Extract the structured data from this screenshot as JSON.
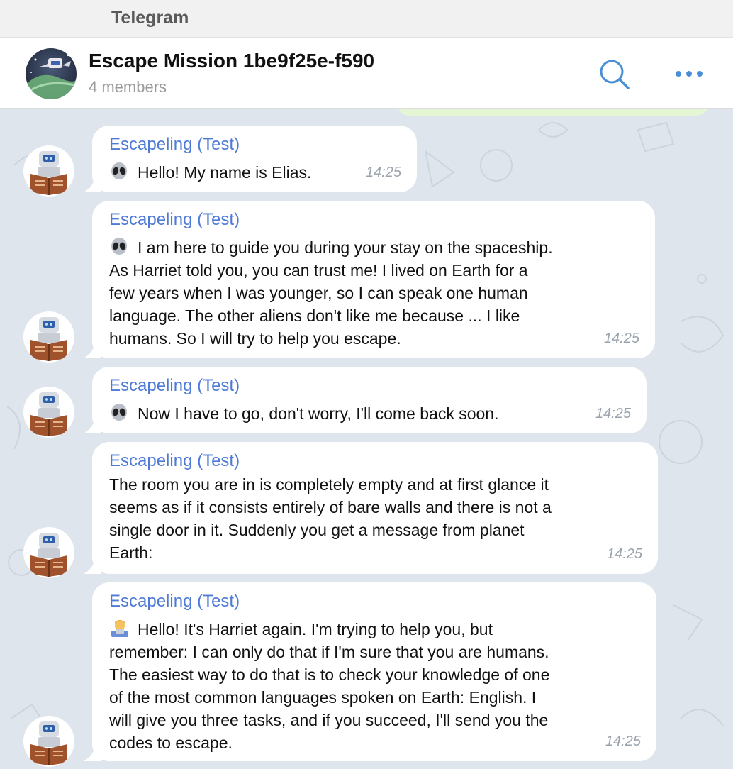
{
  "window": {
    "title": "Telegram"
  },
  "chat": {
    "title": "Escape Mission 1be9f25e-f590",
    "subtitle": "4 members"
  },
  "header_icons": {
    "search": "search-icon",
    "more": "more-dots-icon"
  },
  "colors": {
    "accent": "#4f7bd6",
    "bubble": "#ffffff",
    "background": "#dfe5ec",
    "outgoing_bubble": "#e4f6d4"
  },
  "messages": [
    {
      "sender": "Escapeling (Test)",
      "emoji": "alien",
      "text": "Hello! My name is Elias.",
      "time": "14:25"
    },
    {
      "sender": "Escapeling (Test)",
      "emoji": "alien",
      "text": "I am here to guide you during your stay on the spaceship.\nAs Harriet told you, you can trust me! I lived on Earth for a\nfew years when I was younger, so I can speak one human\nlanguage. The other aliens don't like me because ... I like\nhumans. So I will try to help you escape.",
      "time": "14:25"
    },
    {
      "sender": "Escapeling (Test)",
      "emoji": "alien",
      "text": "Now I have to go, don't worry, I'll come back soon.",
      "time": "14:25"
    },
    {
      "sender": "Escapeling (Test)",
      "emoji": "",
      "text": "The room you are in is completely empty and at first glance it\nseems as if it consists entirely of bare walls and there is not a\nsingle door in it. Suddenly you get a message from planet\nEarth:",
      "time": "14:25"
    },
    {
      "sender": "Escapeling (Test)",
      "emoji": "person-at-laptop",
      "text": "Hello! It's Harriet again. I'm trying to help you, but\nremember: I can only do that if I'm sure that you are humans.\nThe easiest way to do that is to check your knowledge of one\nof the most common languages spoken on Earth: English. I\nwill give you three tasks, and if you succeed, I'll send you the\ncodes to escape.",
      "time": "14:25"
    }
  ]
}
